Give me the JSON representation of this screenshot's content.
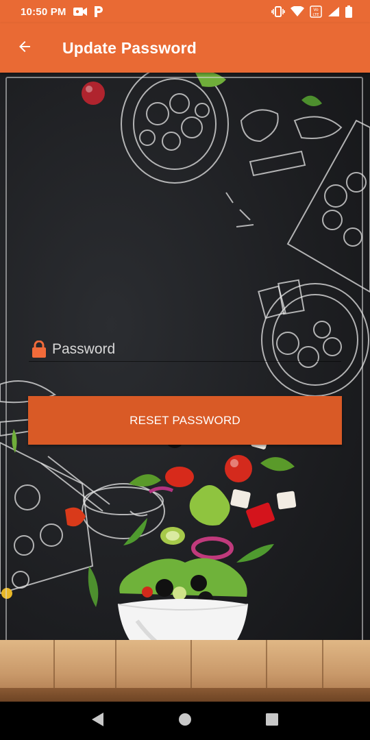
{
  "status_bar": {
    "time": "10:50 PM",
    "left_icons": [
      "video-camera-icon",
      "parking-p-icon"
    ],
    "right_icons": [
      "vibrate-icon",
      "wifi-icon",
      "volte-icon",
      "signal-icon",
      "battery-icon"
    ],
    "volte_label": "VoLTE"
  },
  "app_bar": {
    "title": "Update Password",
    "back_icon": "arrow-left-icon",
    "background": "#e96a34"
  },
  "form": {
    "password_placeholder": "Password",
    "password_value": "",
    "lock_icon": "lock-icon",
    "lock_color": "#f26b3a",
    "reset_button_label": "RESET PASSWORD",
    "button_color": "#d95a26"
  },
  "background": {
    "theme": "chalkboard-food-illustration",
    "foreground": "salad-bowl-on-wooden-table"
  },
  "nav_bar": {
    "back_icon": "nav-back-triangle-icon",
    "home_icon": "nav-home-circle-icon",
    "recents_icon": "nav-recents-square-icon"
  }
}
